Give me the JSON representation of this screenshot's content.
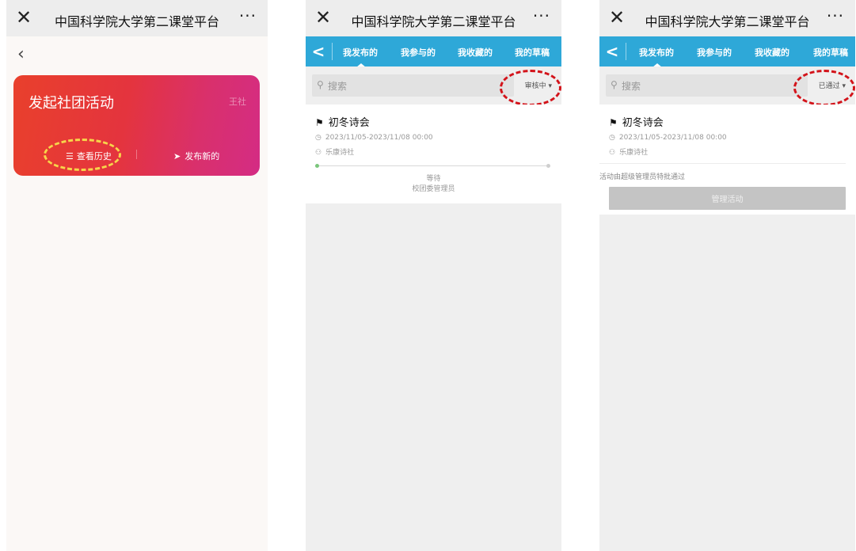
{
  "app_title": "中国科学院大学第二课堂平台",
  "close_glyph": "✕",
  "more_glyph": "···",
  "screen1": {
    "back_glyph": "‹",
    "card_title": "发起社团活动",
    "card_org": "王社",
    "view_history": "查看历史",
    "publish_new": "发布新的",
    "accent_start": "#e9402c",
    "accent_end": "#d42c84",
    "highlight_color": "#f7d54a"
  },
  "tabs": [
    "我发布的",
    "我参与的",
    "我收藏的",
    "我的草稿"
  ],
  "tab_bar_color": "#2ea8d8",
  "search_placeholder": "搜索",
  "screen2": {
    "filter": "审核中 ▾",
    "activity": {
      "name": "初冬诗会",
      "date": "2023/11/05-2023/11/08 00:00",
      "org": "乐康诗社",
      "wait_line1": "等待",
      "wait_line2": "校团委管理员"
    }
  },
  "screen3": {
    "filter": "已通过 ▾",
    "activity": {
      "name": "初冬诗会",
      "date": "2023/11/05-2023/11/08 00:00",
      "org": "乐康诗社",
      "note": "活动由超级管理员特批通过",
      "manage": "管理活动"
    }
  },
  "annotation_color": "#d3131a"
}
